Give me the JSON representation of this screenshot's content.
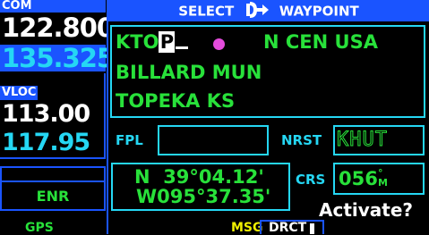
{
  "header": {
    "title_left": "SELECT",
    "title_right": "WAYPOINT"
  },
  "com": {
    "label": "COM",
    "active": "122.800",
    "standby": "135.325"
  },
  "vloc": {
    "label": "VLOC",
    "active": "113.00",
    "standby": "117.95"
  },
  "mode": {
    "enr": "ENR"
  },
  "bottom": {
    "gps": "GPS",
    "msg": "MSG",
    "dct": "DRCT"
  },
  "waypoint": {
    "ident": "KTO",
    "cursor_char": "P",
    "region": "N CEN USA",
    "name": "BILLARD MUN",
    "city": "TOPEKA KS"
  },
  "fpl": {
    "label": "FPL",
    "value": ""
  },
  "nrst": {
    "label": "NRST",
    "value": "KHUT"
  },
  "position": {
    "lat": "N  39°04.12'",
    "lon": "W095°37.35'"
  },
  "crs": {
    "label": "CRS",
    "value": "056",
    "unit_top": "°",
    "unit_bottom": "M"
  },
  "action": {
    "activate": "Activate?"
  },
  "colors": {
    "blue": "#1a54ff",
    "cyan": "#25d7f4",
    "green": "#28e13a",
    "magenta": "#e44cdc",
    "yellow": "#f0f000"
  }
}
